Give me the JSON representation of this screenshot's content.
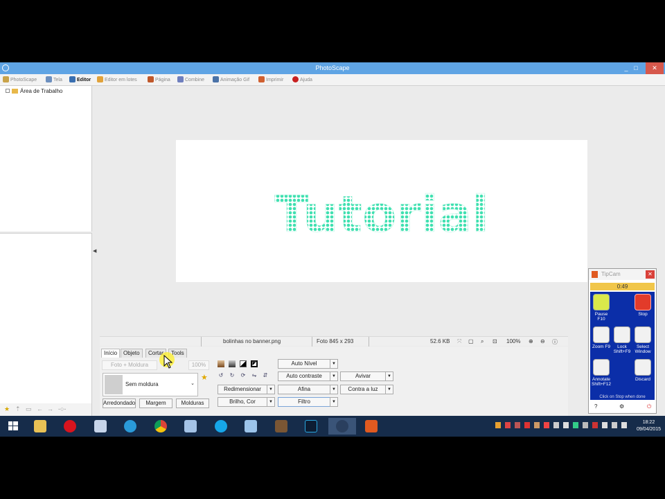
{
  "window": {
    "title": "PhotoScape",
    "controls": {
      "minimize": "_",
      "maximize": "□",
      "close": "✕"
    }
  },
  "tabs": [
    {
      "label": "PhotoScape",
      "icon": "photoscape-icon",
      "color": "#c9a34a"
    },
    {
      "label": "Tela",
      "icon": "viewer-icon",
      "color": "#6c8fbf"
    },
    {
      "label": "Editor",
      "icon": "editor-icon",
      "color": "#3a6fb0"
    },
    {
      "label": "Editor em lotes",
      "icon": "batch-editor-icon",
      "color": "#e1a23a"
    },
    {
      "label": "Página",
      "icon": "page-icon",
      "color": "#c0582a"
    },
    {
      "label": "Combine",
      "icon": "combine-icon",
      "color": "#6f7fbe"
    },
    {
      "label": "Animação Gif",
      "icon": "gif-icon",
      "color": "#4b73a8"
    },
    {
      "label": "Imprimir",
      "icon": "print-icon",
      "color": "#d06030"
    },
    {
      "label": "Ajuda",
      "icon": "help-icon",
      "color": "#c82020"
    }
  ],
  "tree": {
    "root_label": "Área de Trabalho"
  },
  "canvas": {
    "text": "Tutorial",
    "text_color": "#3fe0b0"
  },
  "status": {
    "filename": "bolinhas no banner.png",
    "dimensions": "Foto 845 x 293",
    "filesize": "52.6 KB",
    "zoom": "100%"
  },
  "panel": {
    "tabs": [
      "Início",
      "Objeto",
      "Cortar",
      "Tools"
    ],
    "frame_label": "Foto + Moldura",
    "frame_percent": "100%",
    "frame_select": "Sem moldura",
    "buttons": {
      "rounded": "Arredondado",
      "margin": "Margem",
      "frames": "Molduras",
      "auto_level": "Auto Nível",
      "auto_contrast": "Auto contraste",
      "resize": "Redimensionar",
      "sharpen": "Afina",
      "brightness": "Brilho, Cor",
      "filter": "Filtro",
      "vivid": "Avivar",
      "backlight": "Contra a luz"
    }
  },
  "tipcam": {
    "title": "TipCam",
    "timer": "0:49",
    "buttons": [
      {
        "label": "Pause F10",
        "icon": "pause-icon"
      },
      {
        "label": "Stop",
        "icon": "stop-icon"
      },
      {
        "label": "Zoom F9",
        "icon": "zoom-icon"
      },
      {
        "label": "Lock Shift+F9",
        "icon": "lock-icon"
      },
      {
        "label": "Select Window",
        "icon": "crosshair-icon"
      },
      {
        "label": "Annotate Shift+F12",
        "icon": "annotate-icon"
      },
      {
        "label": "Discard",
        "icon": "trash-icon"
      }
    ],
    "hint": "Click on Stop when done"
  },
  "taskbar": {
    "apps": [
      "start",
      "file-explorer",
      "opera",
      "notepad",
      "internet-explorer",
      "chrome",
      "paint",
      "skype",
      "notes",
      "minecraft",
      "photoshop",
      "photoscape",
      "tipcam"
    ],
    "clock_time": "18:22",
    "clock_date": "09/04/2015"
  }
}
